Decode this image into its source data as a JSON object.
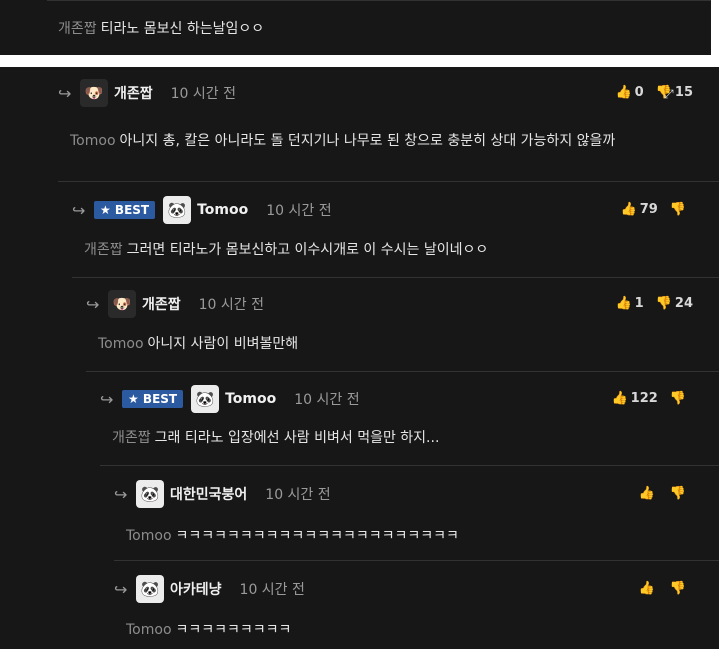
{
  "top": {
    "mention": "개존짭",
    "text": "티라노 몸보신 하는날임ㅇㅇ"
  },
  "comments": [
    {
      "author": "개존짭",
      "time": "10 시간 전",
      "up": "0",
      "down": "15",
      "mention": "Tomoo",
      "text": "아니지 총, 칼은 아니라도 돌 던지기나 나무로 된 창으로 충분히 상대 가능하지 않을까"
    },
    {
      "badge": "★ BEST",
      "author": "Tomoo",
      "time": "10 시간 전",
      "up": "79",
      "down": "",
      "mention": "개존짭",
      "text": "그러면 티라노가 몸보신하고 이수시개로 이 수시는 날이네ㅇㅇ"
    },
    {
      "author": "개존짭",
      "time": "10 시간 전",
      "up": "1",
      "down": "24",
      "mention": "Tomoo",
      "text": "아니지 사람이 비벼볼만해"
    },
    {
      "badge": "★ BEST",
      "author": "Tomoo",
      "time": "10 시간 전",
      "up": "122",
      "down": "",
      "mention": "개존짭",
      "text": "그래 티라노 입장에선 사람 비벼서 먹을만 하지..."
    },
    {
      "author": "대한민국붕어",
      "time": "10 시간 전",
      "up": "",
      "down": "",
      "mention": "Tomoo",
      "text": "ㅋㅋㅋㅋㅋㅋㅋㅋㅋㅋㅋㅋㅋㅋㅋㅋㅋㅋㅋㅋㅋㅋ"
    },
    {
      "author": "아카테냥",
      "time": "10 시간 전",
      "up": "",
      "down": "",
      "mention": "Tomoo",
      "text": "ㅋㅋㅋㅋㅋㅋㅋㅋㅋ"
    }
  ],
  "icons": {
    "reply": "reply-arrow-icon",
    "like": "thumbs-up-icon",
    "dislike": "thumbs-down-icon",
    "expand": "expand-icon"
  }
}
